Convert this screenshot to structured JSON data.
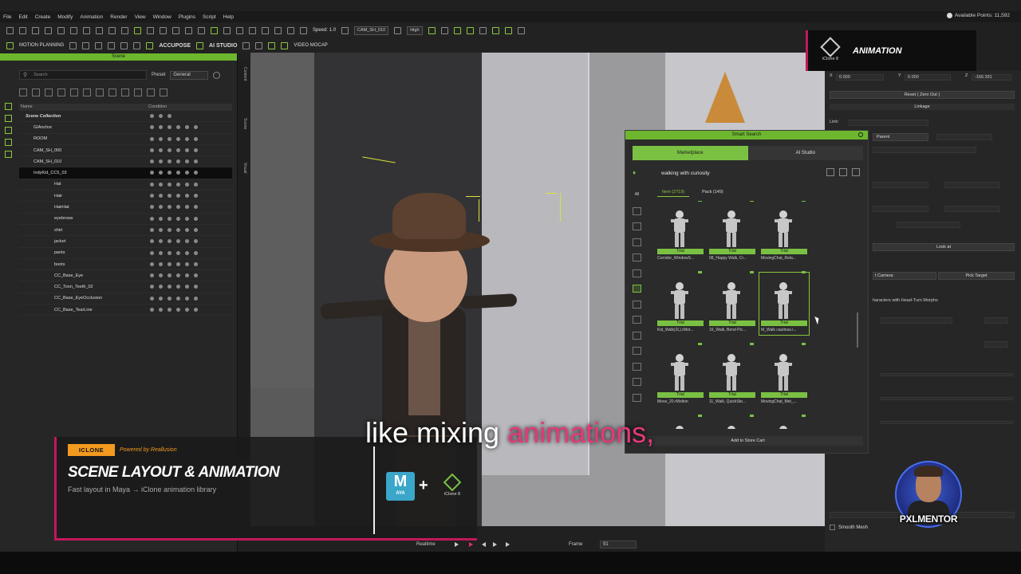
{
  "menu": {
    "items": [
      "File",
      "Edit",
      "Create",
      "Modify",
      "Animation",
      "Render",
      "View",
      "Window",
      "Plugins",
      "Script",
      "Help"
    ],
    "points": "Available Points: 11,592"
  },
  "toolbar": {
    "speed": "Speed: 1.0",
    "camera": "CAM_SH_010",
    "quality": "High",
    "motion_planning": "MOTION PLANNING",
    "accupose": "ACCUPOSE",
    "ai_studio": "AI STUDIO",
    "video_mocap": "VIDEO MOCAP"
  },
  "scene": {
    "title": "Scene",
    "search_placeholder": "Search",
    "preset_label": "Preset",
    "preset_value": "General",
    "col_name": "Name",
    "col_condition": "Condition",
    "items": [
      {
        "label": "Scene Collection",
        "indent": 0
      },
      {
        "label": "GIAnchor",
        "indent": 1
      },
      {
        "label": "ROOM",
        "indent": 1
      },
      {
        "label": "CAM_SH_000",
        "indent": 1
      },
      {
        "label": "CAM_SH_010",
        "indent": 1
      },
      {
        "label": "IndyKid_CC5_03",
        "indent": 1
      },
      {
        "label": "Hat",
        "indent": 2
      },
      {
        "label": "Hair",
        "indent": 2
      },
      {
        "label": "HairHat",
        "indent": 2
      },
      {
        "label": "eyebrows",
        "indent": 2
      },
      {
        "label": "shirt",
        "indent": 2
      },
      {
        "label": "jacket",
        "indent": 2
      },
      {
        "label": "pants",
        "indent": 2
      },
      {
        "label": "boots",
        "indent": 2
      },
      {
        "label": "CC_Base_Eye",
        "indent": 2
      },
      {
        "label": "CC_Toon_Teeth_02",
        "indent": 2
      },
      {
        "label": "CC_Base_EyeOcclusion",
        "indent": 2
      },
      {
        "label": "CC_Base_TearLine",
        "indent": 2
      }
    ]
  },
  "dock_tabs": [
    "Content",
    "Scene",
    "Visual"
  ],
  "smart_search": {
    "title": "Smart Search",
    "tabs": [
      "Marketplace",
      "AI Studio"
    ],
    "query": "walking with curiosity",
    "filter_all": "All",
    "subtabs": [
      "Item (2719)",
      "Pack (149)"
    ],
    "trial_label": "Trial",
    "items": [
      {
        "name": "Corridor_WindowS..."
      },
      {
        "name": "08_Happy Walk, Cr..."
      },
      {
        "name": "MovingChat_Rela..."
      },
      {
        "name": "Kid_Walk(2L).rMot..."
      },
      {
        "name": "16_Walk, Bend Pic..."
      },
      {
        "name": "M_Walk cautious.i..."
      },
      {
        "name": "Move_20.rMotion"
      },
      {
        "name": "11_Walk, QuickSte..."
      },
      {
        "name": "MovingChat_Met_..."
      },
      {
        "name": ""
      },
      {
        "name": ""
      },
      {
        "name": ""
      }
    ],
    "footer": "Add to Store Cart"
  },
  "right_panel": {
    "x_label": "X",
    "x_value": "0.000",
    "y_label": "Y",
    "y_value": "0.000",
    "z_label": "Z",
    "z_value": "-166.391",
    "reset": "Reset ( Zero Out )",
    "linkage": "Linkage",
    "link_label": "Link:",
    "parent": "Parent",
    "look_at": "Look at",
    "camera": "t Camera",
    "pick_target": "Pick Target",
    "morphs": "haracters with Head-Turn Morphs",
    "smooth_mesh": "Smooth Mesh"
  },
  "timeline": {
    "realtime": "Realtime",
    "frame_label": "Frame",
    "frame_value": "91"
  },
  "animation_badge": {
    "logo_text": "iClone 8",
    "title": "ANIMATION"
  },
  "overlay": {
    "tag": "ICLONE",
    "powered": "Powered by Reallusion",
    "title": "SCENE LAYOUT & ANIMATION",
    "subtitle": "Fast layout in Maya → iClone animation library",
    "maya_m": "M",
    "maya_aya": "AYA",
    "plus": "+",
    "iclone_logo": "iClone 8"
  },
  "caption": {
    "prefix": "like mixing ",
    "highlight": "animations,"
  },
  "watermark": {
    "text": "PXLMENTOR"
  },
  "colors": {
    "accent_green": "#7ac143",
    "accent_pink": "#c2185b",
    "accent_orange": "#f29a1f"
  }
}
